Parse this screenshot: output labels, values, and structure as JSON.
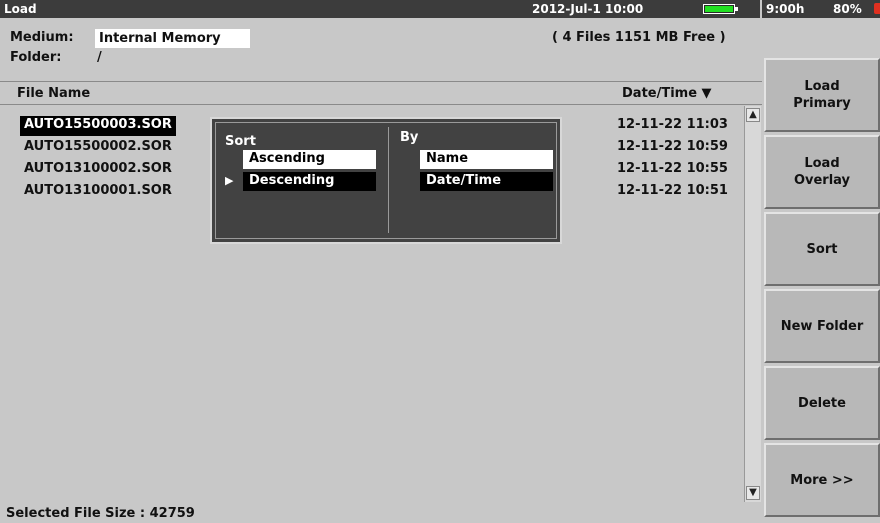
{
  "titlebar": {
    "title": "Load",
    "datetime": "2012-Jul-1 10:00",
    "battery_runtime": "9:00h",
    "battery_percent": "80%"
  },
  "info": {
    "medium_label": "Medium:",
    "medium_value": "Internal Memory",
    "folder_label": "Folder:",
    "folder_value": "/",
    "files_info": "( 4 Files   1151 MB Free )"
  },
  "list": {
    "headers": {
      "name": "File Name",
      "date": "Date/Time ▼"
    },
    "rows": [
      {
        "name": "AUTO15500003.SOR",
        "date": "12-11-22 11:03",
        "selected": true
      },
      {
        "name": "AUTO15500002.SOR",
        "date": "12-11-22 10:59",
        "selected": false
      },
      {
        "name": "AUTO13100002.SOR",
        "date": "12-11-22 10:55",
        "selected": false
      },
      {
        "name": "AUTO13100001.SOR",
        "date": "12-11-22 10:51",
        "selected": false
      }
    ]
  },
  "sort_popup": {
    "sort_label": "Sort",
    "by_label": "By",
    "sort_options": [
      "Ascending",
      "Descending"
    ],
    "sort_selected": "Descending",
    "by_options": [
      "Name",
      "Date/Time"
    ],
    "by_selected": "Date/Time"
  },
  "status": {
    "selected_file_size": "Selected File Size : 42759"
  },
  "softkeys": [
    {
      "label": "Load\nPrimary"
    },
    {
      "label": "Load\nOverlay"
    },
    {
      "label": "Sort"
    },
    {
      "label": "New Folder"
    },
    {
      "label": "Delete"
    },
    {
      "label": "More >>"
    }
  ],
  "icons": {
    "battery": "battery-icon",
    "scroll_up": "scroll-up-icon",
    "scroll_down": "scroll-down-icon",
    "pointer": "triangle-right-icon"
  },
  "colors": {
    "titlebar": "#3c3c3c",
    "battery_fill": "#22e022",
    "popup_bg": "#424242",
    "background": "#c8c8c8"
  }
}
